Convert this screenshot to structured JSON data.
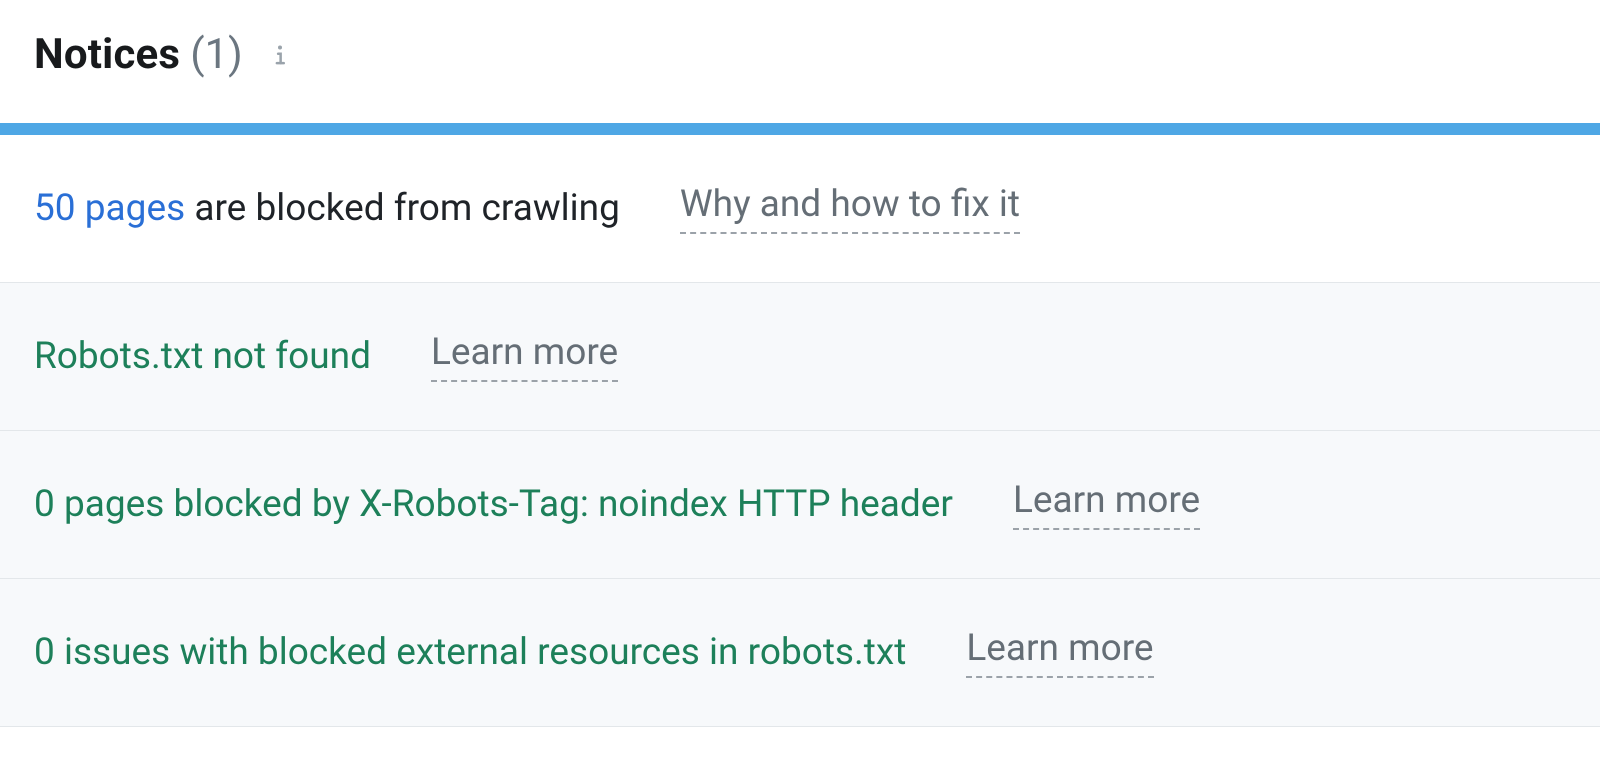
{
  "header": {
    "title": "Notices",
    "count": "(1)"
  },
  "rows": [
    {
      "lead_link": "50 pages",
      "lead_text": " are blocked from crawling",
      "secondary": "Why and how to fix it",
      "kind": "primary"
    },
    {
      "lead_green": "Robots.txt not found",
      "secondary": "Learn more",
      "kind": "sub"
    },
    {
      "lead_green": "0 pages blocked by X-Robots-Tag: noindex HTTP header",
      "secondary": "Learn more",
      "kind": "sub"
    },
    {
      "lead_green": "0 issues with blocked external resources in robots.txt",
      "secondary": "Learn more",
      "kind": "sub"
    }
  ]
}
